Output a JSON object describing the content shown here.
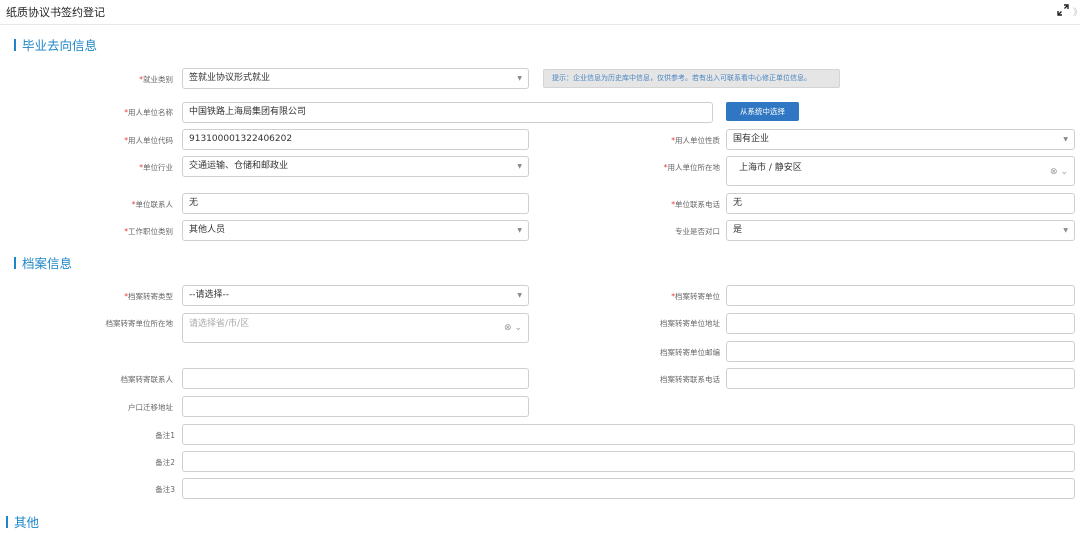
{
  "window": {
    "title": "纸质协议书签约登记",
    "edge_mark": "》",
    "expand_icon": "expand-icon"
  },
  "sections": {
    "graduation": "毕业去向信息",
    "archive": "档案信息",
    "other": "其他"
  },
  "graduation": {
    "employment_category": {
      "label": "就业类别",
      "required": "*",
      "value": "签就业协议形式就业"
    },
    "tip": "提示：企业信息为历史库中信息，仅供参考。若有出入可联系看中心修正单位信息。",
    "employer_name": {
      "label": "用人单位名称",
      "required": "*",
      "value": "中国铁路上海局集团有限公司"
    },
    "select_from_system_button": "从系统中选择",
    "employer_code": {
      "label": "用人单位代码",
      "required": "*",
      "value": "913100001322406202"
    },
    "employer_nature": {
      "label": "用人单位性质",
      "required": "*",
      "value": "国有企业"
    },
    "industry": {
      "label": "单位行业",
      "required": "*",
      "value": "交通运输、仓储和邮政业"
    },
    "employer_location": {
      "label": "用人单位所在地",
      "required": "*",
      "value": "上海市 / 静安区"
    },
    "contact_person": {
      "label": "单位联系人",
      "required": "*",
      "value": "无"
    },
    "contact_phone": {
      "label": "单位联系电话",
      "required": "*",
      "value": "无"
    },
    "job_category": {
      "label": "工作职位类别",
      "required": "*",
      "value": "其他人员"
    },
    "major_match": {
      "label": "专业是否对口",
      "value": "是"
    }
  },
  "archive": {
    "transfer_type": {
      "label": "档案转寄类型",
      "required": "*",
      "value": "--请选择--"
    },
    "transfer_unit": {
      "label": "档案转寄单位",
      "required": "*",
      "value": ""
    },
    "unit_location": {
      "label": "档案转寄单位所在地",
      "placeholder": "请选择省/市/区"
    },
    "unit_address": {
      "label": "档案转寄单位地址",
      "value": ""
    },
    "unit_postcode": {
      "label": "档案转寄单位邮编",
      "value": ""
    },
    "contact_person": {
      "label": "档案转寄联系人",
      "value": ""
    },
    "contact_phone": {
      "label": "档案转寄联系电话",
      "value": ""
    },
    "hukou_address": {
      "label": "户口迁移地址",
      "value": ""
    },
    "remark1": {
      "label": "备注1",
      "value": ""
    },
    "remark2": {
      "label": "备注2",
      "value": ""
    },
    "remark3": {
      "label": "备注3",
      "value": ""
    }
  },
  "icons": {
    "dropdown_arrow": "▼",
    "clear": "⊗",
    "chevron": "⌄"
  },
  "colors": {
    "accent": "#1c86c8",
    "required": "#e83a3a",
    "button": "#2f77c2",
    "tip_text": "#4a86c4"
  }
}
